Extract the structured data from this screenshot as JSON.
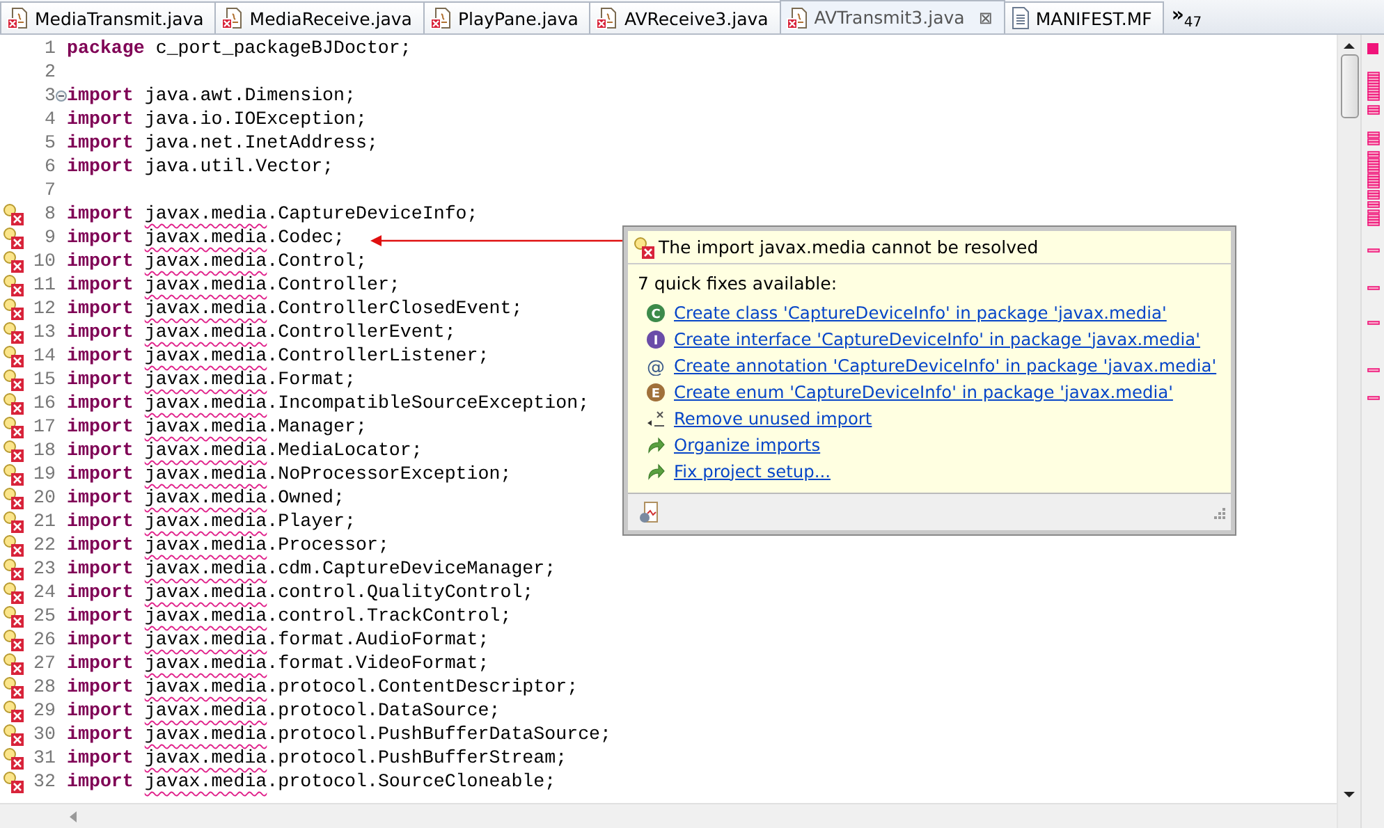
{
  "tabs": [
    {
      "label": "MediaTransmit.java",
      "kind": "java",
      "error": true,
      "selected": false
    },
    {
      "label": "MediaReceive.java",
      "kind": "java",
      "error": true,
      "selected": false
    },
    {
      "label": "PlayPane.java",
      "kind": "java",
      "error": true,
      "selected": false
    },
    {
      "label": "AVReceive3.java",
      "kind": "java",
      "error": true,
      "selected": false
    },
    {
      "label": "AVTransmit3.java",
      "kind": "java",
      "error": true,
      "selected": true,
      "close": "⊠"
    },
    {
      "label": "MANIFEST.MF",
      "kind": "text",
      "error": false,
      "selected": false
    }
  ],
  "overflow": {
    "chevron": "»",
    "count": "47"
  },
  "lines": [
    {
      "number": "1",
      "keyword": "package",
      "rest": "c_port_packageBJDoctor;",
      "error": false
    },
    {
      "number": "2",
      "error": false
    },
    {
      "number": "3",
      "keyword": "import",
      "rest": "java.awt.Dimension;",
      "error": false,
      "fold": true
    },
    {
      "number": "4",
      "keyword": "import",
      "rest": "java.io.IOException;",
      "error": false
    },
    {
      "number": "5",
      "keyword": "import",
      "rest": "java.net.InetAddress;",
      "error": false
    },
    {
      "number": "6",
      "keyword": "import",
      "rest": "java.util.Vector;",
      "error": false
    },
    {
      "number": "7",
      "error": false
    },
    {
      "number": "8",
      "keyword": "import",
      "unresolved": "javax.media",
      "rest": ".CaptureDeviceInfo;",
      "error": true
    },
    {
      "number": "9",
      "keyword": "import",
      "unresolved": "javax.media",
      "rest": ".Codec;",
      "error": true
    },
    {
      "number": "10",
      "keyword": "import",
      "unresolved": "javax.media",
      "rest": ".Control;",
      "error": true
    },
    {
      "number": "11",
      "keyword": "import",
      "unresolved": "javax.media",
      "rest": ".Controller;",
      "error": true
    },
    {
      "number": "12",
      "keyword": "import",
      "unresolved": "javax.media",
      "rest": ".ControllerClosedEvent;",
      "error": true
    },
    {
      "number": "13",
      "keyword": "import",
      "unresolved": "javax.media",
      "rest": ".ControllerEvent;",
      "error": true
    },
    {
      "number": "14",
      "keyword": "import",
      "unresolved": "javax.media",
      "rest": ".ControllerListener;",
      "error": true
    },
    {
      "number": "15",
      "keyword": "import",
      "unresolved": "javax.media",
      "rest": ".Format;",
      "error": true
    },
    {
      "number": "16",
      "keyword": "import",
      "unresolved": "javax.media",
      "rest": ".IncompatibleSourceException;",
      "error": true
    },
    {
      "number": "17",
      "keyword": "import",
      "unresolved": "javax.media",
      "rest": ".Manager;",
      "error": true
    },
    {
      "number": "18",
      "keyword": "import",
      "unresolved": "javax.media",
      "rest": ".MediaLocator;",
      "error": true
    },
    {
      "number": "19",
      "keyword": "import",
      "unresolved": "javax.media",
      "rest": ".NoProcessorException;",
      "error": true
    },
    {
      "number": "20",
      "keyword": "import",
      "unresolved": "javax.media",
      "rest": ".Owned;",
      "error": true
    },
    {
      "number": "21",
      "keyword": "import",
      "unresolved": "javax.media",
      "rest": ".Player;",
      "error": true
    },
    {
      "number": "22",
      "keyword": "import",
      "unresolved": "javax.media",
      "rest": ".Processor;",
      "error": true
    },
    {
      "number": "23",
      "keyword": "import",
      "unresolved": "javax.media",
      "rest": ".cdm.CaptureDeviceManager;",
      "error": true
    },
    {
      "number": "24",
      "keyword": "import",
      "unresolved": "javax.media",
      "rest": ".control.QualityControl;",
      "error": true
    },
    {
      "number": "25",
      "keyword": "import",
      "unresolved": "javax.media",
      "rest": ".control.TrackControl;",
      "error": true
    },
    {
      "number": "26",
      "keyword": "import",
      "unresolved": "javax.media",
      "rest": ".format.AudioFormat;",
      "error": true
    },
    {
      "number": "27",
      "keyword": "import",
      "unresolved": "javax.media",
      "rest": ".format.VideoFormat;",
      "error": true
    },
    {
      "number": "28",
      "keyword": "import",
      "unresolved": "javax.media",
      "rest": ".protocol.ContentDescriptor;",
      "error": true
    },
    {
      "number": "29",
      "keyword": "import",
      "unresolved": "javax.media",
      "rest": ".protocol.DataSource;",
      "error": true
    },
    {
      "number": "30",
      "keyword": "import",
      "unresolved": "javax.media",
      "rest": ".protocol.PushBufferDataSource;",
      "error": true
    },
    {
      "number": "31",
      "keyword": "import",
      "unresolved": "javax.media",
      "rest": ".protocol.PushBufferStream;",
      "error": true
    },
    {
      "number": "32",
      "keyword": "import",
      "unresolved": "javax.media",
      "rest": ".protocol.SourceCloneable;",
      "error": true
    }
  ],
  "popup": {
    "message": "The import javax.media cannot be resolved",
    "count": "7 quick fixes available:",
    "fixes": [
      {
        "kind": "class",
        "letter": "C",
        "label": "Create class 'CaptureDeviceInfo' in package 'javax.media'"
      },
      {
        "kind": "interface",
        "letter": "I",
        "label": "Create interface 'CaptureDeviceInfo' in package 'javax.media'"
      },
      {
        "kind": "annotation",
        "letter": "@",
        "label": "Create annotation 'CaptureDeviceInfo' in package 'javax.media'"
      },
      {
        "kind": "enum",
        "letter": "E",
        "label": "Create enum 'CaptureDeviceInfo' in package 'javax.media'"
      },
      {
        "kind": "remove",
        "label": "Remove unused import"
      },
      {
        "kind": "change",
        "label": "Organize imports"
      },
      {
        "kind": "change",
        "label": "Fix project setup..."
      }
    ]
  }
}
